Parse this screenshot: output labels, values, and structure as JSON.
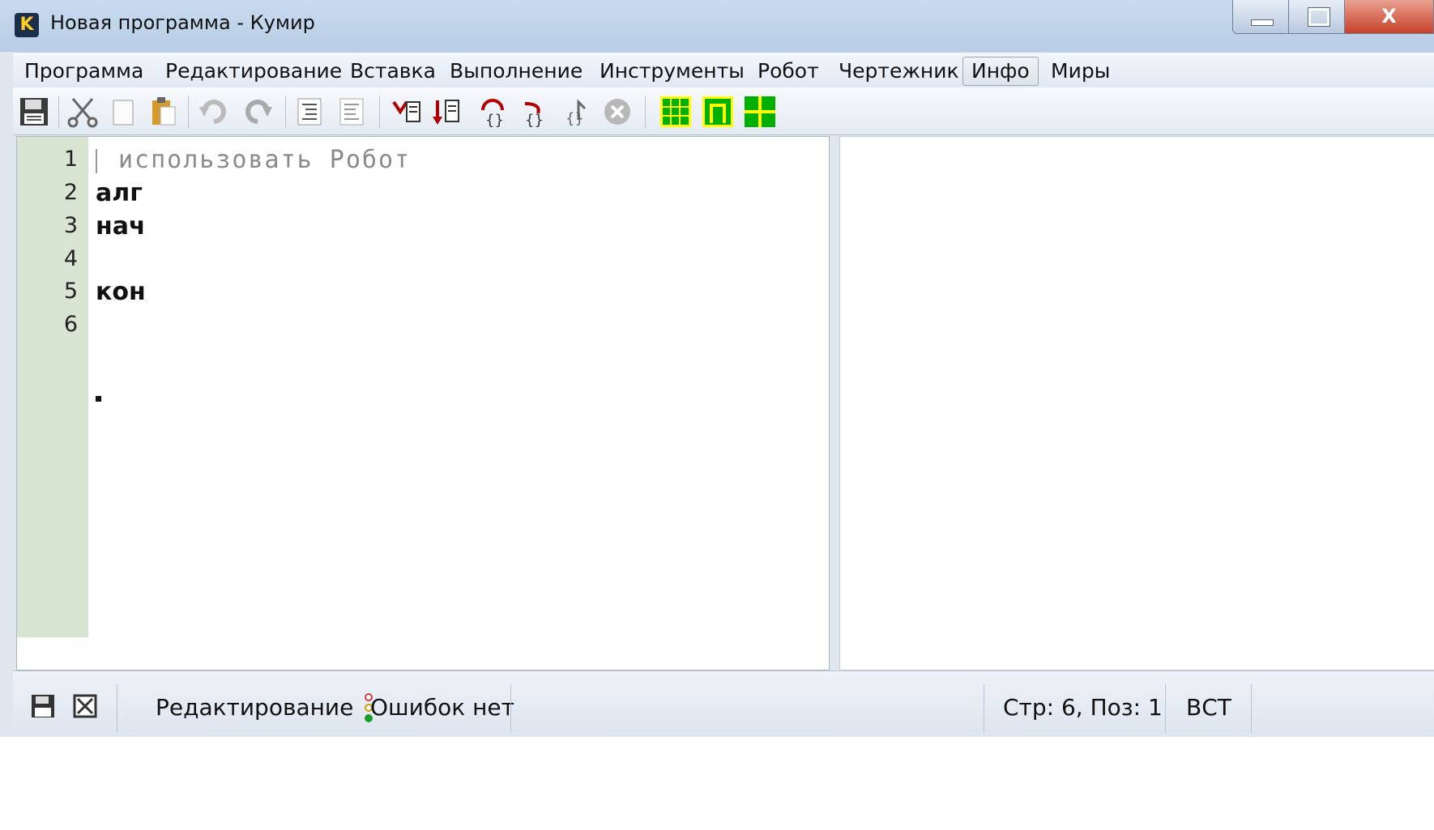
{
  "window": {
    "title": "Новая программа - Кумир",
    "icon_letter": "K",
    "close_glyph": "X"
  },
  "menu": {
    "items": [
      "Программа",
      "Редактирование",
      "Вставка",
      "Выполнение",
      "Инструменты",
      "Робот",
      "Чертежник",
      "Инфо",
      "Миры"
    ],
    "active": "Инфо"
  },
  "toolbar": {
    "buttons": [
      "save-icon",
      "cut-icon",
      "copy-icon",
      "paste-icon",
      "undo-icon",
      "redo-icon",
      "indent-icon",
      "unindent-icon",
      "run-icon",
      "step-run-icon",
      "step-into-icon",
      "step-over-icon",
      "step-out-icon",
      "stop-icon",
      "robot-grid-icon",
      "drawer-icon",
      "worlds-icon"
    ]
  },
  "editor": {
    "lines": [
      {
        "no": "1",
        "text": "использовать Робот",
        "style": "comment"
      },
      {
        "no": "2",
        "text": "алг",
        "style": "bold"
      },
      {
        "no": "3",
        "text": "нач",
        "style": "bold"
      },
      {
        "no": "4",
        "text": "",
        "style": "plain"
      },
      {
        "no": "5",
        "text": "кон",
        "style": "bold"
      },
      {
        "no": "6",
        "text": "",
        "style": "plain"
      }
    ]
  },
  "status": {
    "mode": "Редактирование",
    "errors": "Ошибок нет",
    "position": "Стр: 6, Поз: 1",
    "insert_mode": "ВСТ"
  },
  "colors": {
    "gutter": "#d9e5d3",
    "titlebar": "#b7cde6",
    "close_button": "#c8412a",
    "toolbar_green": "#00c000"
  }
}
